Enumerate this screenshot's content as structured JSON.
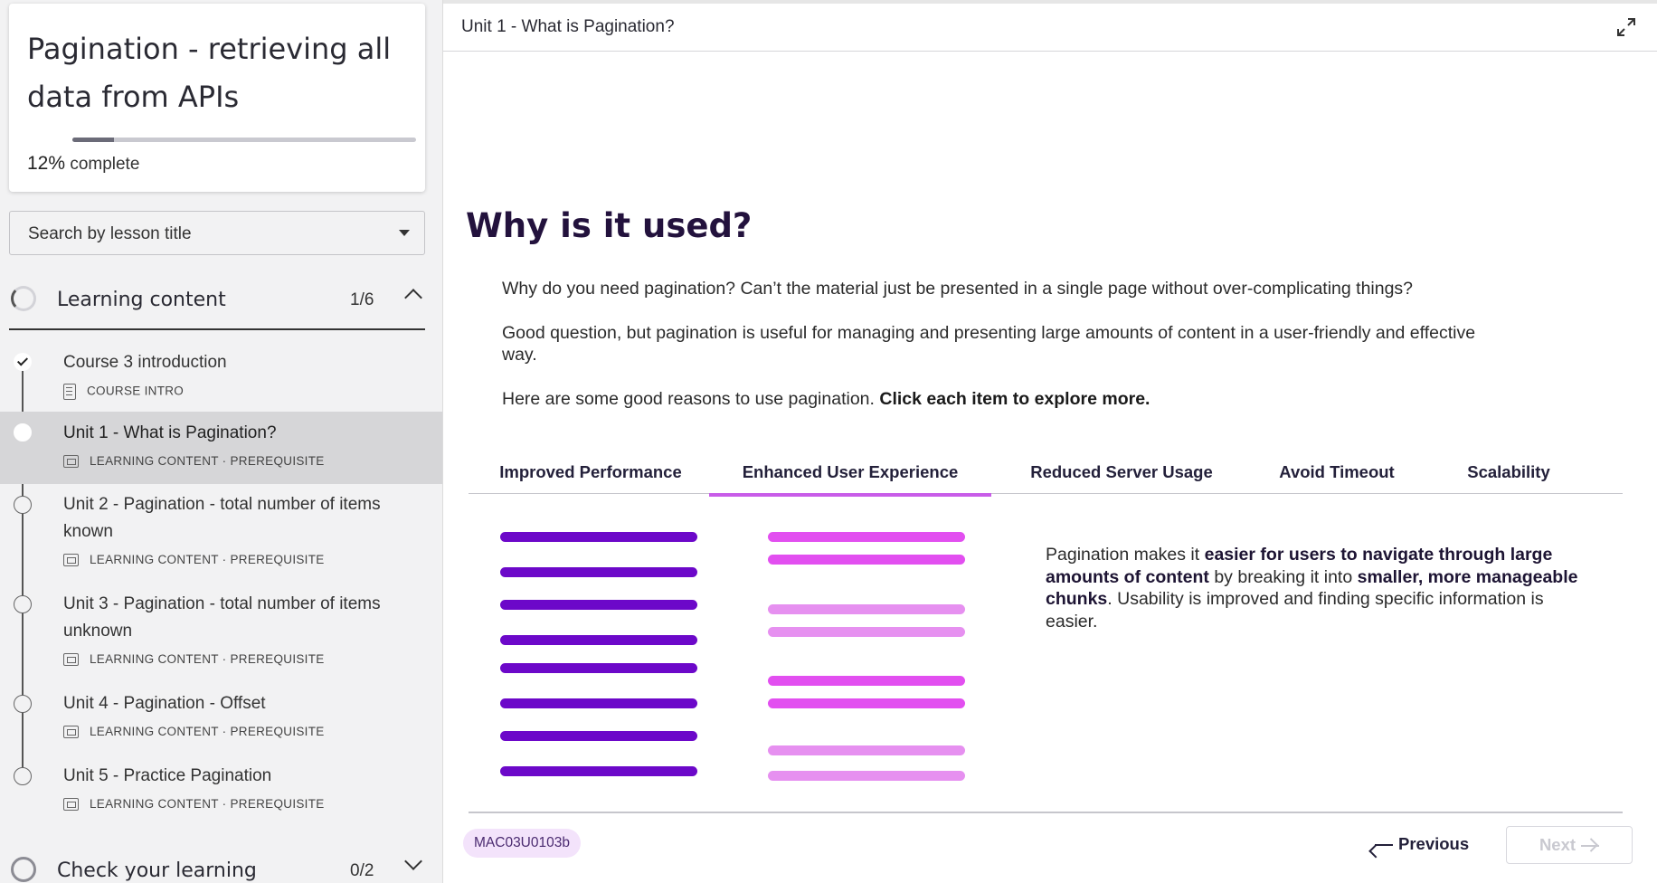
{
  "sidebar": {
    "course_title": "Pagination - retrieving all data from APIs",
    "progress": {
      "percent_label": "12%",
      "complete_label": "complete",
      "fraction": 0.12
    },
    "search": {
      "placeholder": "Search by lesson title"
    },
    "sections": [
      {
        "title": "Learning content",
        "count": "1/6",
        "expanded": true
      },
      {
        "title": "Check your learning",
        "count": "0/2",
        "expanded": false
      }
    ],
    "lessons": [
      {
        "title": "Course 3 introduction",
        "meta": "COURSE INTRO",
        "icon": "document-icon",
        "done": true
      },
      {
        "title": "Unit 1 - What is Pagination?",
        "meta": "LEARNING CONTENT · PREREQUISITE",
        "icon": "slides-icon",
        "active": true
      },
      {
        "title": "Unit 2 - Pagination - total number of items known",
        "meta": "LEARNING CONTENT · PREREQUISITE",
        "icon": "slides-icon"
      },
      {
        "title": "Unit 3 - Pagination - total number of items unknown",
        "meta": "LEARNING CONTENT · PREREQUISITE",
        "icon": "slides-icon"
      },
      {
        "title": "Unit 4 - Pagination - Offset",
        "meta": "LEARNING CONTENT · PREREQUISITE",
        "icon": "slides-icon"
      },
      {
        "title": "Unit 5 - Practice Pagination",
        "meta": "LEARNING CONTENT · PREREQUISITE",
        "icon": "slides-icon"
      }
    ]
  },
  "main": {
    "unit_title": "Unit 1 - What is Pagination?",
    "heading": "Why is it used?",
    "para1": "Why do you need pagination? Can’t the material just be presented in a single page without over-complicating things?",
    "para2": "Good question, but pagination is useful for managing and presenting large amounts of content in a user-friendly and effective way.",
    "para3_normal": "Here are some good reasons to use pagination. ",
    "para3_bold": "Click each item to explore more.",
    "tabs": [
      {
        "label": "Improved Performance"
      },
      {
        "label": "Enhanced User Experience",
        "active": true
      },
      {
        "label": "Reduced Server Usage"
      },
      {
        "label": "Avoid Timeout"
      },
      {
        "label": "Scalability"
      }
    ],
    "panel": {
      "t1": "Pagination makes it ",
      "b1": "easier for users to navigate through large amounts of content",
      "t2": " by breaking it into ",
      "b2": "smaller, more manageable chunks",
      "t3": ". Usability is improved and finding specific information is easier."
    },
    "illustration": {
      "left_color": "#6c08c9",
      "right_colors": [
        "#e24ff0",
        "#e690f0"
      ]
    },
    "footer": {
      "code": "MAC03U0103b",
      "prev_label": "Previous",
      "next_label": "Next"
    }
  },
  "colors": {
    "accent": "#c85ce8",
    "heading": "#23123d"
  }
}
